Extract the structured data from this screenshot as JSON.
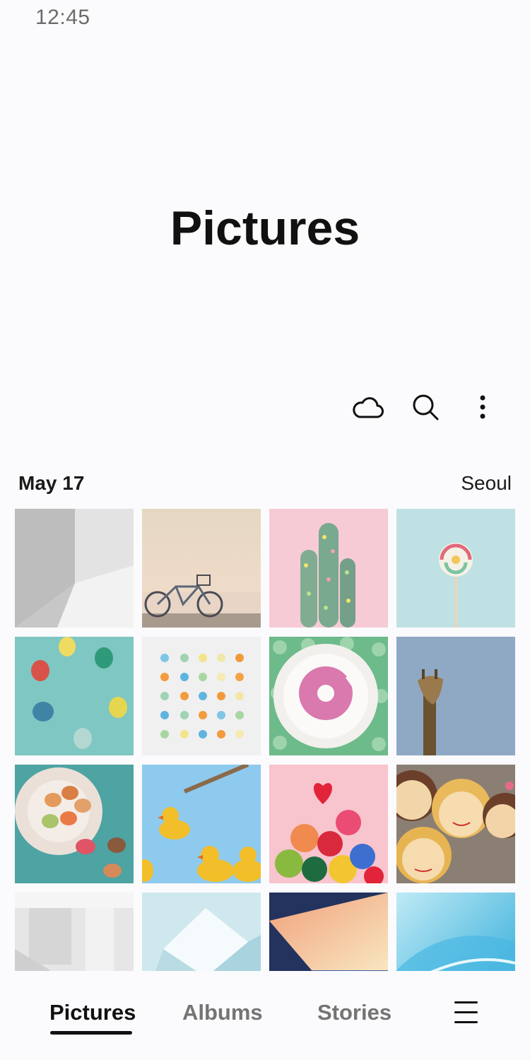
{
  "status_bar": {
    "time": "12:45"
  },
  "header": {
    "title": "Pictures"
  },
  "toolbar": {
    "icons": [
      "cloud-icon",
      "search-icon",
      "more-options-icon"
    ]
  },
  "section": {
    "date": "May 17",
    "location": "Seoul"
  },
  "photos": [
    "white architecture",
    "bicycle at sunset",
    "pink cactus",
    "lollipop",
    "colored eggs",
    "candy grid",
    "pink donut",
    "giraffe",
    "macarons",
    "rubber ducks",
    "heart balloons",
    "face cookies",
    "white interior",
    "white cube",
    "stairs to light",
    "blue wave"
  ],
  "bottom_nav": {
    "tabs": [
      "Pictures",
      "Albums",
      "Stories"
    ],
    "active_tab": "Pictures",
    "menu_icon": "menu-icon"
  },
  "colors": {
    "accent": "#111111",
    "inactive": "#747474",
    "background": "#fbfbfd"
  }
}
